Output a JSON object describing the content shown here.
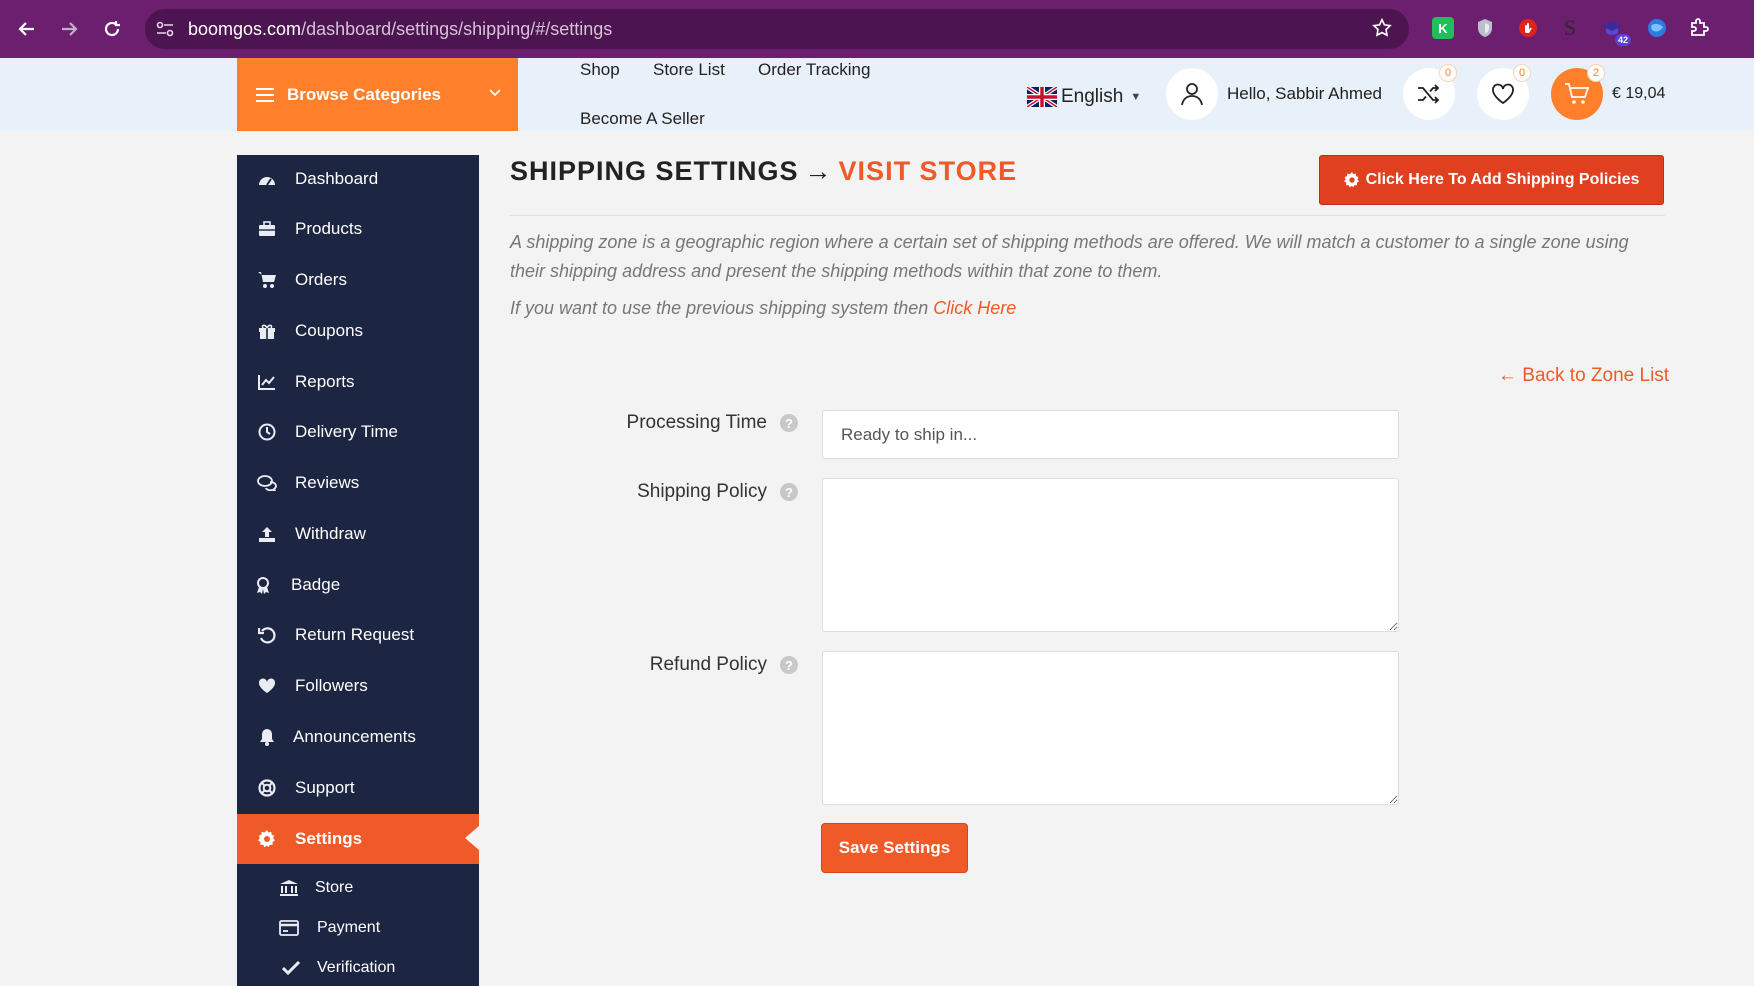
{
  "browser": {
    "url_host": "boomgos.com",
    "url_path": "/dashboard/settings/shipping/#/settings",
    "extensions": [
      {
        "name": "k-extension-icon",
        "label": "K",
        "color": "#1fbf5a"
      },
      {
        "name": "shield-extension-icon",
        "label": "",
        "color": "#b9c0cc"
      },
      {
        "name": "hand-extension-icon",
        "label": "",
        "color": "#e2231a"
      },
      {
        "name": "s-extension-icon",
        "label": "S",
        "color": "#6b1f6e"
      },
      {
        "name": "cap-extension-icon",
        "label": "",
        "color": "#3b2a9e",
        "badge": "42"
      },
      {
        "name": "globe-extension-icon",
        "label": "",
        "color": "#2c7be5"
      }
    ]
  },
  "header": {
    "browse_label": "Browse Categories",
    "nav": [
      "Shop",
      "Store List",
      "Order Tracking",
      "Become A Seller"
    ],
    "language": "English",
    "greeting": "Hello, Sabbir Ahmed",
    "compare_count": "0",
    "wishlist_count": "0",
    "cart_count": "2",
    "cart_total": "€ 19,04"
  },
  "sidebar": {
    "items": [
      {
        "label": "Dashboard",
        "icon": "dashboard-icon"
      },
      {
        "label": "Products",
        "icon": "briefcase-icon"
      },
      {
        "label": "Orders",
        "icon": "cart-icon"
      },
      {
        "label": "Coupons",
        "icon": "gift-icon"
      },
      {
        "label": "Reports",
        "icon": "chart-icon"
      },
      {
        "label": "Delivery Time",
        "icon": "clock-icon"
      },
      {
        "label": "Reviews",
        "icon": "comments-icon"
      },
      {
        "label": "Withdraw",
        "icon": "upload-icon"
      },
      {
        "label": "Badge",
        "icon": "award-icon"
      },
      {
        "label": "Return Request",
        "icon": "undo-icon"
      },
      {
        "label": "Followers",
        "icon": "heart-icon"
      },
      {
        "label": "Announcements",
        "icon": "bell-icon"
      },
      {
        "label": "Support",
        "icon": "lifebuoy-icon"
      },
      {
        "label": "Settings",
        "icon": "gear-icon",
        "active": true
      }
    ],
    "sub_items": [
      {
        "label": "Store",
        "icon": "bank-icon"
      },
      {
        "label": "Payment",
        "icon": "credit-card-icon"
      },
      {
        "label": "Verification",
        "icon": "check-icon"
      }
    ]
  },
  "main": {
    "title": "SHIPPING SETTINGS",
    "title_arrow": "→",
    "visit_store": "VISIT STORE",
    "add_policies_button": "Click Here To Add Shipping Policies",
    "description": "A shipping zone is a geographic region where a certain set of shipping methods are offered. We will match a customer to a single zone using their shipping address and present the shipping methods within that zone to them.",
    "previous_system_text": "If you want to use the previous shipping system then",
    "previous_system_link": "Click Here",
    "back_link": "← Back to Zone List",
    "form": {
      "processing_time_label": "Processing Time",
      "processing_time_placeholder": "Ready to ship in...",
      "shipping_policy_label": "Shipping Policy",
      "refund_policy_label": "Refund Policy",
      "help_glyph": "?",
      "save_button": "Save Settings"
    }
  },
  "colors": {
    "accent": "#f05a28",
    "browse_orange": "#ff7f2a",
    "sidebar_bg": "#1c2541",
    "browser_purple": "#6b1f6e"
  }
}
